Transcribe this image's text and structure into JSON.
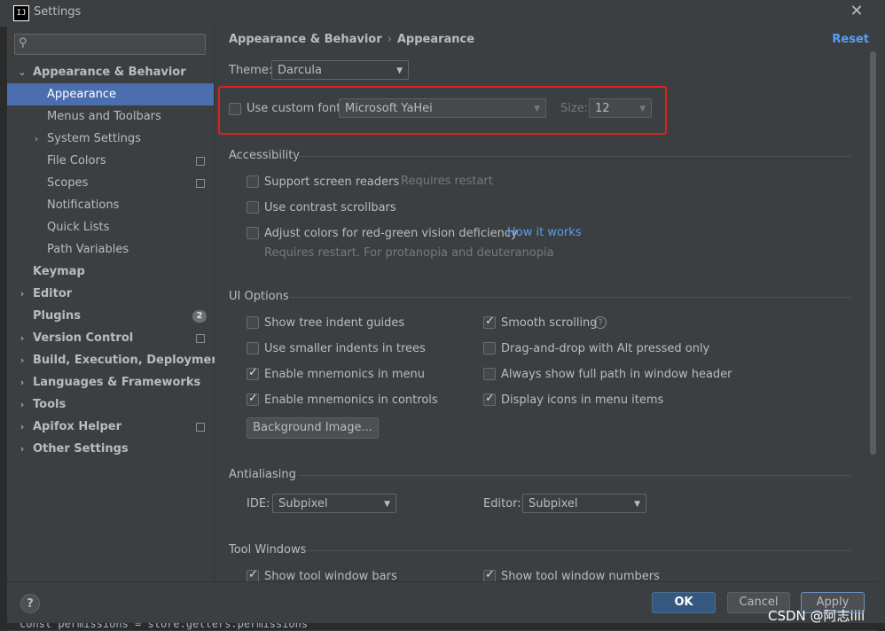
{
  "window": {
    "title": "Settings",
    "logo_text": "IJ"
  },
  "search": {
    "placeholder": ""
  },
  "sidebar": {
    "items": [
      {
        "label": "Appearance & Behavior"
      },
      {
        "label": "Appearance"
      },
      {
        "label": "Menus and Toolbars"
      },
      {
        "label": "System Settings"
      },
      {
        "label": "File Colors"
      },
      {
        "label": "Scopes"
      },
      {
        "label": "Notifications"
      },
      {
        "label": "Quick Lists"
      },
      {
        "label": "Path Variables"
      },
      {
        "label": "Keymap"
      },
      {
        "label": "Editor"
      },
      {
        "label": "Plugins",
        "badge": "2"
      },
      {
        "label": "Version Control"
      },
      {
        "label": "Build, Execution, Deployment"
      },
      {
        "label": "Languages & Frameworks"
      },
      {
        "label": "Tools"
      },
      {
        "label": "Apifox Helper"
      },
      {
        "label": "Other Settings"
      }
    ]
  },
  "header": {
    "crumb1": "Appearance & Behavior",
    "separator": "›",
    "crumb2": "Appearance",
    "reset": "Reset"
  },
  "theme": {
    "label": "Theme:",
    "value": "Darcula"
  },
  "font": {
    "checkbox_label": "Use custom font:",
    "value": "Microsoft YaHei",
    "size_label": "Size:",
    "size_value": "12"
  },
  "accessibility": {
    "title": "Accessibility",
    "screen_readers": "Support screen readers",
    "screen_readers_hint": "Requires restart",
    "contrast": "Use contrast scrollbars",
    "adjust": "Adjust colors for red-green vision deficiency",
    "how_link": "How it works",
    "adjust_hint": "Requires restart. For protanopia and deuteranopia"
  },
  "ui_options": {
    "title": "UI Options",
    "left": [
      "Show tree indent guides",
      "Use smaller indents in trees",
      "Enable mnemonics in menu",
      "Enable mnemonics in controls"
    ],
    "right": [
      "Smooth scrolling",
      "Drag-and-drop with Alt pressed only",
      "Always show full path in window header",
      "Display icons in menu items"
    ],
    "bg_button": "Background Image..."
  },
  "antialiasing": {
    "title": "Antialiasing",
    "ide_label": "IDE:",
    "ide_value": "Subpixel",
    "editor_label": "Editor:",
    "editor_value": "Subpixel"
  },
  "tool_windows": {
    "title": "Tool Windows",
    "left": "Show tool window bars",
    "right": "Show tool window numbers"
  },
  "footer": {
    "help": "?",
    "ok": "OK",
    "cancel": "Cancel",
    "apply": "Apply"
  },
  "watermark": "CSDN @阿志iiii",
  "code_text": "const permissions = store.getters.permissions"
}
